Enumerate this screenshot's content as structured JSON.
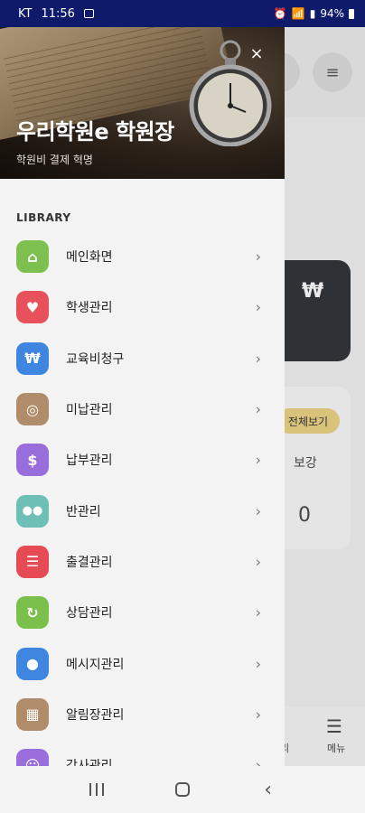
{
  "status": {
    "carrier": "KT",
    "time": "11:56",
    "battery": "94%"
  },
  "drawer": {
    "title": "우리학원e 학원장",
    "subtitle": "학원비 결제 혁명",
    "close_label": "×",
    "section": "LIBRARY",
    "items": [
      {
        "label": "메인화면",
        "icon": "home-icon",
        "color": "#7dc050",
        "glyph": "⌂"
      },
      {
        "label": "학생관리",
        "icon": "heart-icon",
        "color": "#e8505b",
        "glyph": "♥"
      },
      {
        "label": "교육비청구",
        "icon": "won-icon",
        "color": "#3f86e0",
        "glyph": "₩"
      },
      {
        "label": "미납관리",
        "icon": "target-icon",
        "color": "#b08c6a",
        "glyph": "◎"
      },
      {
        "label": "납부관리",
        "icon": "dollar-icon",
        "color": "#9a6ddc",
        "glyph": "$"
      },
      {
        "label": "반관리",
        "icon": "group-icon",
        "color": "#6ec0b6",
        "glyph": "👥"
      },
      {
        "label": "출결관리",
        "icon": "checklist-icon",
        "color": "#e64a55",
        "glyph": "☰"
      },
      {
        "label": "상담관리",
        "icon": "refresh-icon",
        "color": "#7cc04c",
        "glyph": "↻"
      },
      {
        "label": "메시지관리",
        "icon": "chat-icon",
        "color": "#3f86e0",
        "glyph": "💬"
      },
      {
        "label": "알림장관리",
        "icon": "grid-icon",
        "color": "#b08c6a",
        "glyph": "▦"
      },
      {
        "label": "강사관리",
        "icon": "user-icon",
        "color": "#9a6ddc",
        "glyph": "☺"
      }
    ]
  },
  "background": {
    "won_symbol": "₩",
    "view_all": "전체보기",
    "makeup_label": "보강",
    "makeup_count": "0",
    "menu_label": "메뉴",
    "ri_label": "리"
  }
}
